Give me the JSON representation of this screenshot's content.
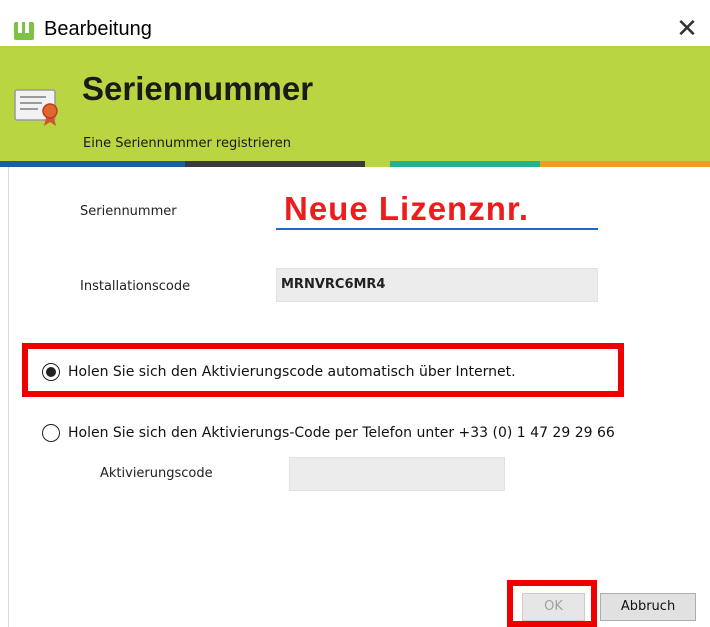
{
  "window": {
    "title": "Bearbeitung"
  },
  "banner": {
    "title": "Seriennummer",
    "subtitle": "Eine Seriennummer registrieren",
    "stripe_colors": [
      "#1c5f9d",
      "#3a3a3a",
      "#b9d542",
      "#22b38a",
      "#f39c1f"
    ]
  },
  "form": {
    "serial": {
      "label": "Seriennummer",
      "handwritten_value": "Neue Lizenznr."
    },
    "install_code": {
      "label": "Installationscode",
      "value": "MRNVRC6MR4"
    },
    "options": [
      {
        "label": "Holen Sie sich den Aktivierungscode automatisch über Internet.",
        "selected": true
      },
      {
        "label": "Holen Sie sich den Aktivierungs-Code per Telefon unter +33 (0) 1 47 29 29 66",
        "selected": false
      }
    ],
    "activation_code": {
      "label": "Aktivierungscode",
      "value": ""
    }
  },
  "buttons": {
    "ok": "OK",
    "cancel": "Abbruch"
  },
  "colors": {
    "banner": "#b9d542",
    "annotation": "#ee1c1c",
    "underline": "#1b6ac9"
  }
}
